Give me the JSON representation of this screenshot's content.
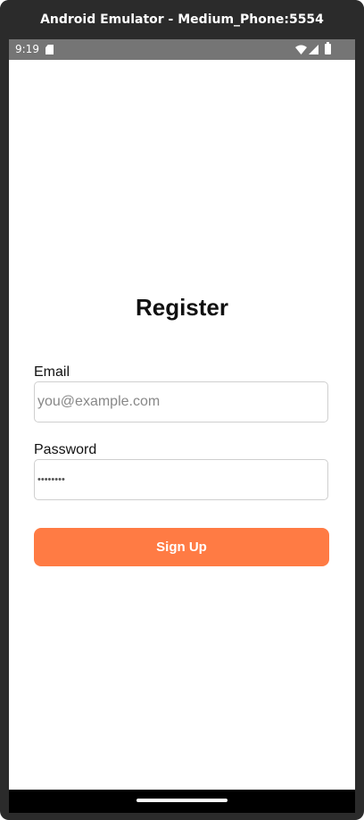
{
  "window": {
    "title": "Android Emulator - Medium_Phone:5554"
  },
  "status_bar": {
    "time": "9:19",
    "icons": [
      "sd-card-icon",
      "wifi-icon",
      "signal-icon",
      "battery-icon"
    ]
  },
  "register": {
    "title": "Register",
    "email": {
      "label": "Email",
      "placeholder": "you@example.com",
      "value": ""
    },
    "password": {
      "label": "Password",
      "value": "••••••••"
    },
    "submit_label": "Sign Up"
  },
  "colors": {
    "accent": "#ff7b44",
    "status_bar": "#757575",
    "frame": "#2b2b2b"
  }
}
